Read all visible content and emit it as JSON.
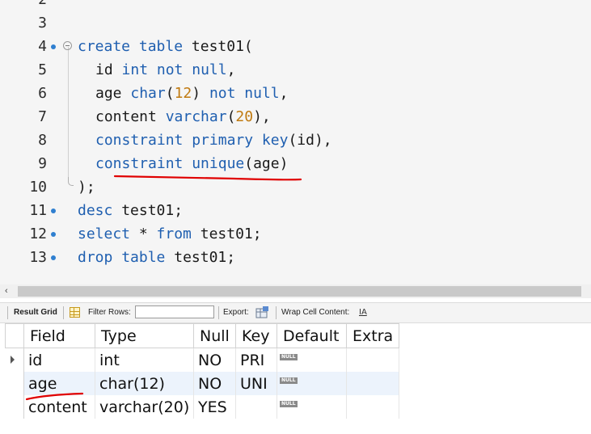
{
  "editor": {
    "lines": [
      {
        "num": "2",
        "tokens": []
      },
      {
        "num": "3",
        "tokens": []
      },
      {
        "num": "4",
        "dot": true,
        "fold": "start",
        "indent": 0,
        "tokens": [
          {
            "t": "create",
            "c": "kw"
          },
          {
            "t": " "
          },
          {
            "t": "table",
            "c": "kw"
          },
          {
            "t": " test01("
          }
        ]
      },
      {
        "num": "5",
        "indent": 1,
        "tokens": [
          {
            "t": "id "
          },
          {
            "t": "int",
            "c": "kw"
          },
          {
            "t": " "
          },
          {
            "t": "not",
            "c": "kw"
          },
          {
            "t": " "
          },
          {
            "t": "null",
            "c": "kw"
          },
          {
            "t": ","
          }
        ]
      },
      {
        "num": "6",
        "indent": 1,
        "tokens": [
          {
            "t": "age "
          },
          {
            "t": "char",
            "c": "kw"
          },
          {
            "t": "("
          },
          {
            "t": "12",
            "c": "num"
          },
          {
            "t": ") "
          },
          {
            "t": "not",
            "c": "kw"
          },
          {
            "t": " "
          },
          {
            "t": "null",
            "c": "kw"
          },
          {
            "t": ","
          }
        ]
      },
      {
        "num": "7",
        "indent": 1,
        "tokens": [
          {
            "t": "content "
          },
          {
            "t": "varchar",
            "c": "kw"
          },
          {
            "t": "("
          },
          {
            "t": "20",
            "c": "num"
          },
          {
            "t": "),"
          }
        ]
      },
      {
        "num": "8",
        "indent": 1,
        "tokens": [
          {
            "t": "constraint",
            "c": "kw"
          },
          {
            "t": " "
          },
          {
            "t": "primary",
            "c": "kw"
          },
          {
            "t": " "
          },
          {
            "t": "key",
            "c": "kw"
          },
          {
            "t": "(id),"
          }
        ]
      },
      {
        "num": "9",
        "indent": 1,
        "tokens": [
          {
            "t": "constraint",
            "c": "kw"
          },
          {
            "t": " "
          },
          {
            "t": "unique",
            "c": "kw"
          },
          {
            "t": "(age)"
          }
        ]
      },
      {
        "num": "10",
        "fold": "end",
        "indent": 0,
        "tokens": [
          {
            "t": ");"
          }
        ]
      },
      {
        "num": "11",
        "dot": true,
        "indent": 0,
        "tokens": [
          {
            "t": "desc",
            "c": "kw"
          },
          {
            "t": " test01;"
          }
        ]
      },
      {
        "num": "12",
        "dot": true,
        "indent": 0,
        "tokens": [
          {
            "t": "select",
            "c": "kw"
          },
          {
            "t": " * "
          },
          {
            "t": "from",
            "c": "kw"
          },
          {
            "t": " test01;"
          }
        ]
      },
      {
        "num": "13",
        "dot": true,
        "indent": 0,
        "tokens": [
          {
            "t": "drop",
            "c": "kw"
          },
          {
            "t": " "
          },
          {
            "t": "table",
            "c": "kw"
          },
          {
            "t": " test01;"
          }
        ]
      }
    ]
  },
  "toolbar": {
    "result_grid_label": "Result Grid",
    "filter_rows_label": "Filter Rows:",
    "filter_value": "",
    "export_label": "Export:",
    "wrap_label": "Wrap Cell Content:",
    "wrap_icon_glyph": "IA"
  },
  "grid": {
    "columns": [
      "Field",
      "Type",
      "Null",
      "Key",
      "Default",
      "Extra"
    ],
    "null_badge": "NULL",
    "rows": [
      {
        "field": "id",
        "type": "int",
        "null": "NO",
        "key": "PRI",
        "default_is_null": true,
        "extra": ""
      },
      {
        "field": "age",
        "type": "char(12)",
        "null": "NO",
        "key": "UNI",
        "default_is_null": true,
        "extra": ""
      },
      {
        "field": "content",
        "type": "varchar(20)",
        "null": "YES",
        "key": "",
        "default_is_null": true,
        "extra": ""
      }
    ]
  },
  "colors": {
    "keyword": "#1f5fb0",
    "number": "#c07a10",
    "annotation": "#e00000",
    "line_dot": "#2f7fd0"
  }
}
